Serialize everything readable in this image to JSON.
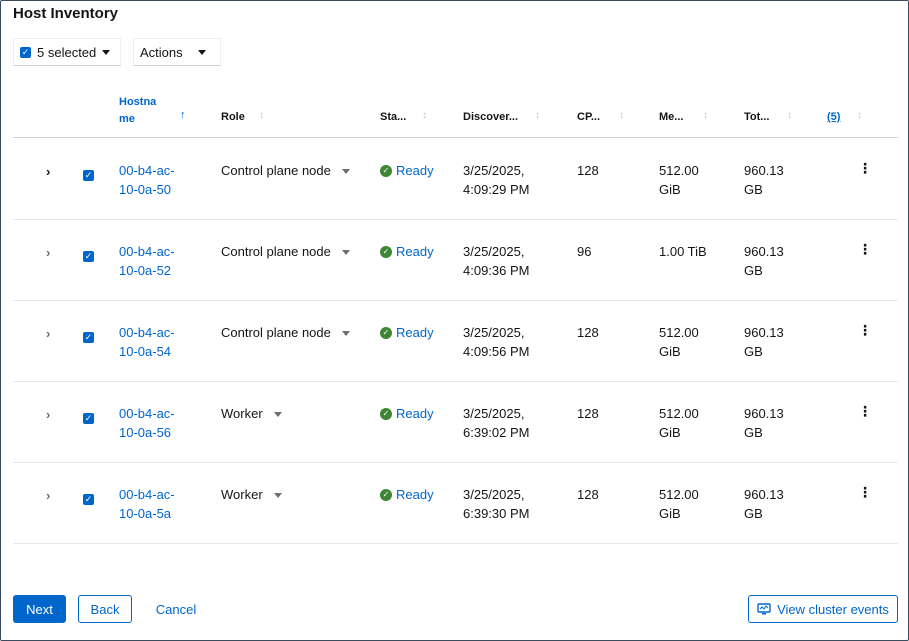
{
  "title": "Host Inventory",
  "toolbar": {
    "bulk_select_label": "5 selected",
    "actions_label": "Actions"
  },
  "columns": {
    "hostname": "Hostna me",
    "role": "Role",
    "status": "Sta...",
    "discovered": "Discover...",
    "cpu": "CP...",
    "memory": "Me...",
    "total": "Tot...",
    "count": "(5)"
  },
  "rows": [
    {
      "host_1": "00-b4-ac-",
      "host_2": "10-0a-50",
      "role": "Control plane node",
      "status": "Ready",
      "date": "3/25/2025,",
      "time": "4:09:29 PM",
      "cpu": "128",
      "mem_1": "512.00",
      "mem_2": "GiB",
      "total_1": "960.13",
      "total_2": "GB"
    },
    {
      "host_1": "00-b4-ac-",
      "host_2": "10-0a-52",
      "role": "Control plane node",
      "status": "Ready",
      "date": "3/25/2025,",
      "time": "4:09:36 PM",
      "cpu": "96",
      "mem_1": "1.00 TiB",
      "mem_2": "",
      "total_1": "960.13",
      "total_2": "GB"
    },
    {
      "host_1": "00-b4-ac-",
      "host_2": "10-0a-54",
      "role": "Control plane node",
      "status": "Ready",
      "date": "3/25/2025,",
      "time": "4:09:56 PM",
      "cpu": "128",
      "mem_1": "512.00",
      "mem_2": "GiB",
      "total_1": "960.13",
      "total_2": "GB"
    },
    {
      "host_1": "00-b4-ac-",
      "host_2": "10-0a-56",
      "role": "Worker",
      "status": "Ready",
      "date": "3/25/2025,",
      "time": "6:39:02 PM",
      "cpu": "128",
      "mem_1": "512.00",
      "mem_2": "GiB",
      "total_1": "960.13",
      "total_2": "GB"
    },
    {
      "host_1": "00-b4-ac-",
      "host_2": "10-0a-5a",
      "role": "Worker",
      "status": "Ready",
      "date": "3/25/2025,",
      "time": "6:39:30 PM",
      "cpu": "128",
      "mem_1": "512.00",
      "mem_2": "GiB",
      "total_1": "960.13",
      "total_2": "GB"
    }
  ],
  "footer": {
    "next_label": "Next",
    "back_label": "Back",
    "cancel_label": "Cancel",
    "events_label": "View cluster events"
  },
  "icons": {
    "expand": "chevron-right-icon",
    "status_ok": "check-circle-icon",
    "kebab": "kebab-menu-icon",
    "events": "monitor-icon"
  },
  "colors": {
    "accent": "#0066cc",
    "success": "#3e8635"
  }
}
